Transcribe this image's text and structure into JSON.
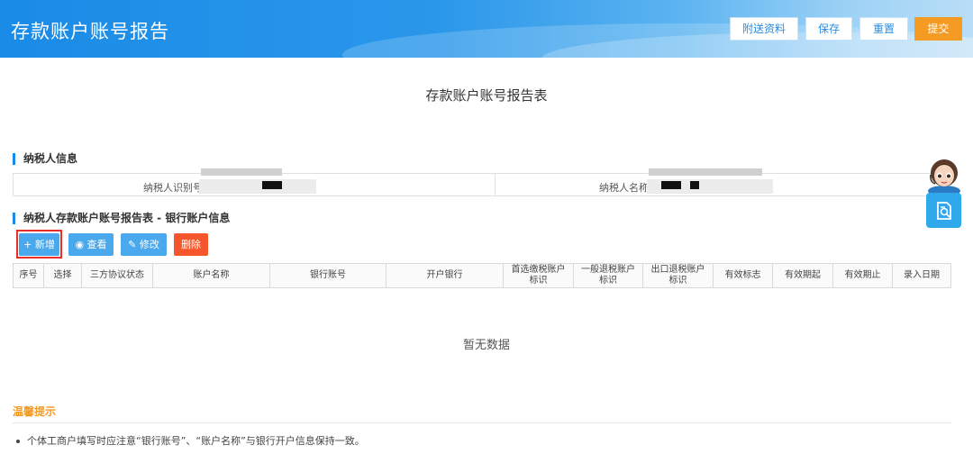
{
  "header": {
    "title": "存款账户账号报告",
    "buttons": {
      "attach": "附送资料",
      "save": "保存",
      "reset": "重置",
      "submit": "提交"
    }
  },
  "report_title": "存款账户账号报告表",
  "taxpayer_section": {
    "title": "纳税人信息",
    "id_label": "纳税人识别号",
    "name_label": "纳税人名称"
  },
  "bank_section": {
    "title": "纳税人存款账户账号报告表 - 银行账户信息",
    "buttons": {
      "add": "+ 新增",
      "view": "查看",
      "edit": "修改",
      "delete": "删除"
    },
    "columns": [
      "序号",
      "选择",
      "三方协议状态",
      "账户名称",
      "银行账号",
      "开户银行",
      "首选缴税账户标识",
      "一般退税账户标识",
      "出口退税账户标识",
      "有效标志",
      "有效期起",
      "有效期止",
      "录入日期"
    ],
    "empty_text": "暂无数据"
  },
  "tips": {
    "title": "温馨提示",
    "items": [
      "个体工商户填写时应注意“银行账号”、“账户名称”与银行开户信息保持一致。"
    ]
  },
  "colors": {
    "brand_blue": "#1a8be6",
    "submit_orange": "#f59a23",
    "delete_red": "#f5562b"
  }
}
